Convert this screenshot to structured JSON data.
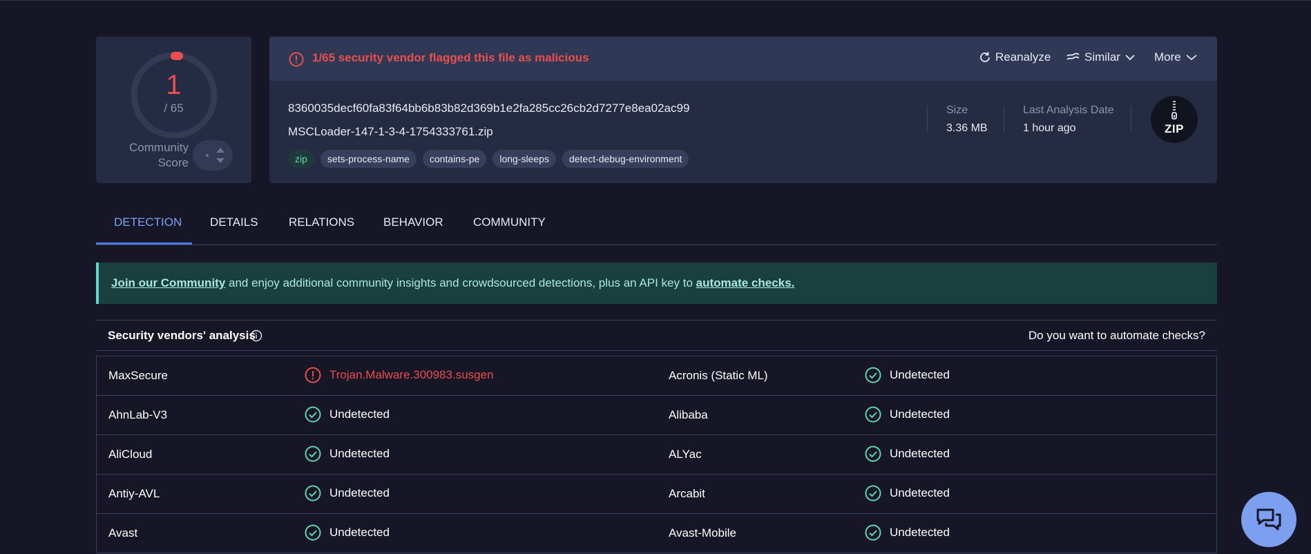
{
  "score": {
    "detections": "1",
    "total": "/ 65",
    "community_label_line1": "Community",
    "community_label_line2": "Score",
    "vote_value": "-"
  },
  "alert": {
    "text": "1/65 security vendor flagged this file as malicious"
  },
  "header_buttons": {
    "reanalyze": "Reanalyze",
    "similar": "Similar",
    "more": "More"
  },
  "file": {
    "hash": "8360035decf60fa83f64bb6b83b82d369b1e2fa285cc26cb2d7277e8ea02ac99",
    "name": "MSCLoader-147-1-3-4-1754333761.zip",
    "tags": [
      "zip",
      "sets-process-name",
      "contains-pe",
      "long-sleeps",
      "detect-debug-environment"
    ],
    "size_label": "Size",
    "size_value": "3.36 MB",
    "date_label": "Last Analysis Date",
    "date_value": "1 hour ago",
    "type_icon_text": "ZIP"
  },
  "tabs": [
    "DETECTION",
    "DETAILS",
    "RELATIONS",
    "BEHAVIOR",
    "COMMUNITY"
  ],
  "banner": {
    "link1": "Join our Community",
    "middle": " and enjoy additional community insights and crowdsourced detections, plus an API key to ",
    "link2": "automate checks."
  },
  "vendors_section": {
    "title": "Security vendors' analysis",
    "right_text": "Do you want to automate checks?"
  },
  "vendors": [
    {
      "left_name": "MaxSecure",
      "left_result": "Trojan.Malware.300983.susgen",
      "left_status": "malicious",
      "right_name": "Acronis (Static ML)",
      "right_result": "Undetected",
      "right_status": "undetected"
    },
    {
      "left_name": "AhnLab-V3",
      "left_result": "Undetected",
      "left_status": "undetected",
      "right_name": "Alibaba",
      "right_result": "Undetected",
      "right_status": "undetected"
    },
    {
      "left_name": "AliCloud",
      "left_result": "Undetected",
      "left_status": "undetected",
      "right_name": "ALYac",
      "right_result": "Undetected",
      "right_status": "undetected"
    },
    {
      "left_name": "Antiy-AVL",
      "left_result": "Undetected",
      "left_status": "undetected",
      "right_name": "Arcabit",
      "right_result": "Undetected",
      "right_status": "undetected"
    },
    {
      "left_name": "Avast",
      "left_result": "Undetected",
      "left_status": "undetected",
      "right_name": "Avast-Mobile",
      "right_result": "Undetected",
      "right_status": "undetected"
    }
  ],
  "colors": {
    "malicious": "#ea4e4e",
    "undetected": "#5fd6b0",
    "accent": "#7aa3f5"
  },
  "icons": {
    "alert": "exclamation-circle-icon",
    "reanalyze": "refresh-icon",
    "similar": "similar-icon",
    "chevron": "chevron-down-icon",
    "info": "info-icon",
    "ok": "check-circle-icon",
    "chat": "chat-icon",
    "file_type": "zip-file-icon"
  }
}
